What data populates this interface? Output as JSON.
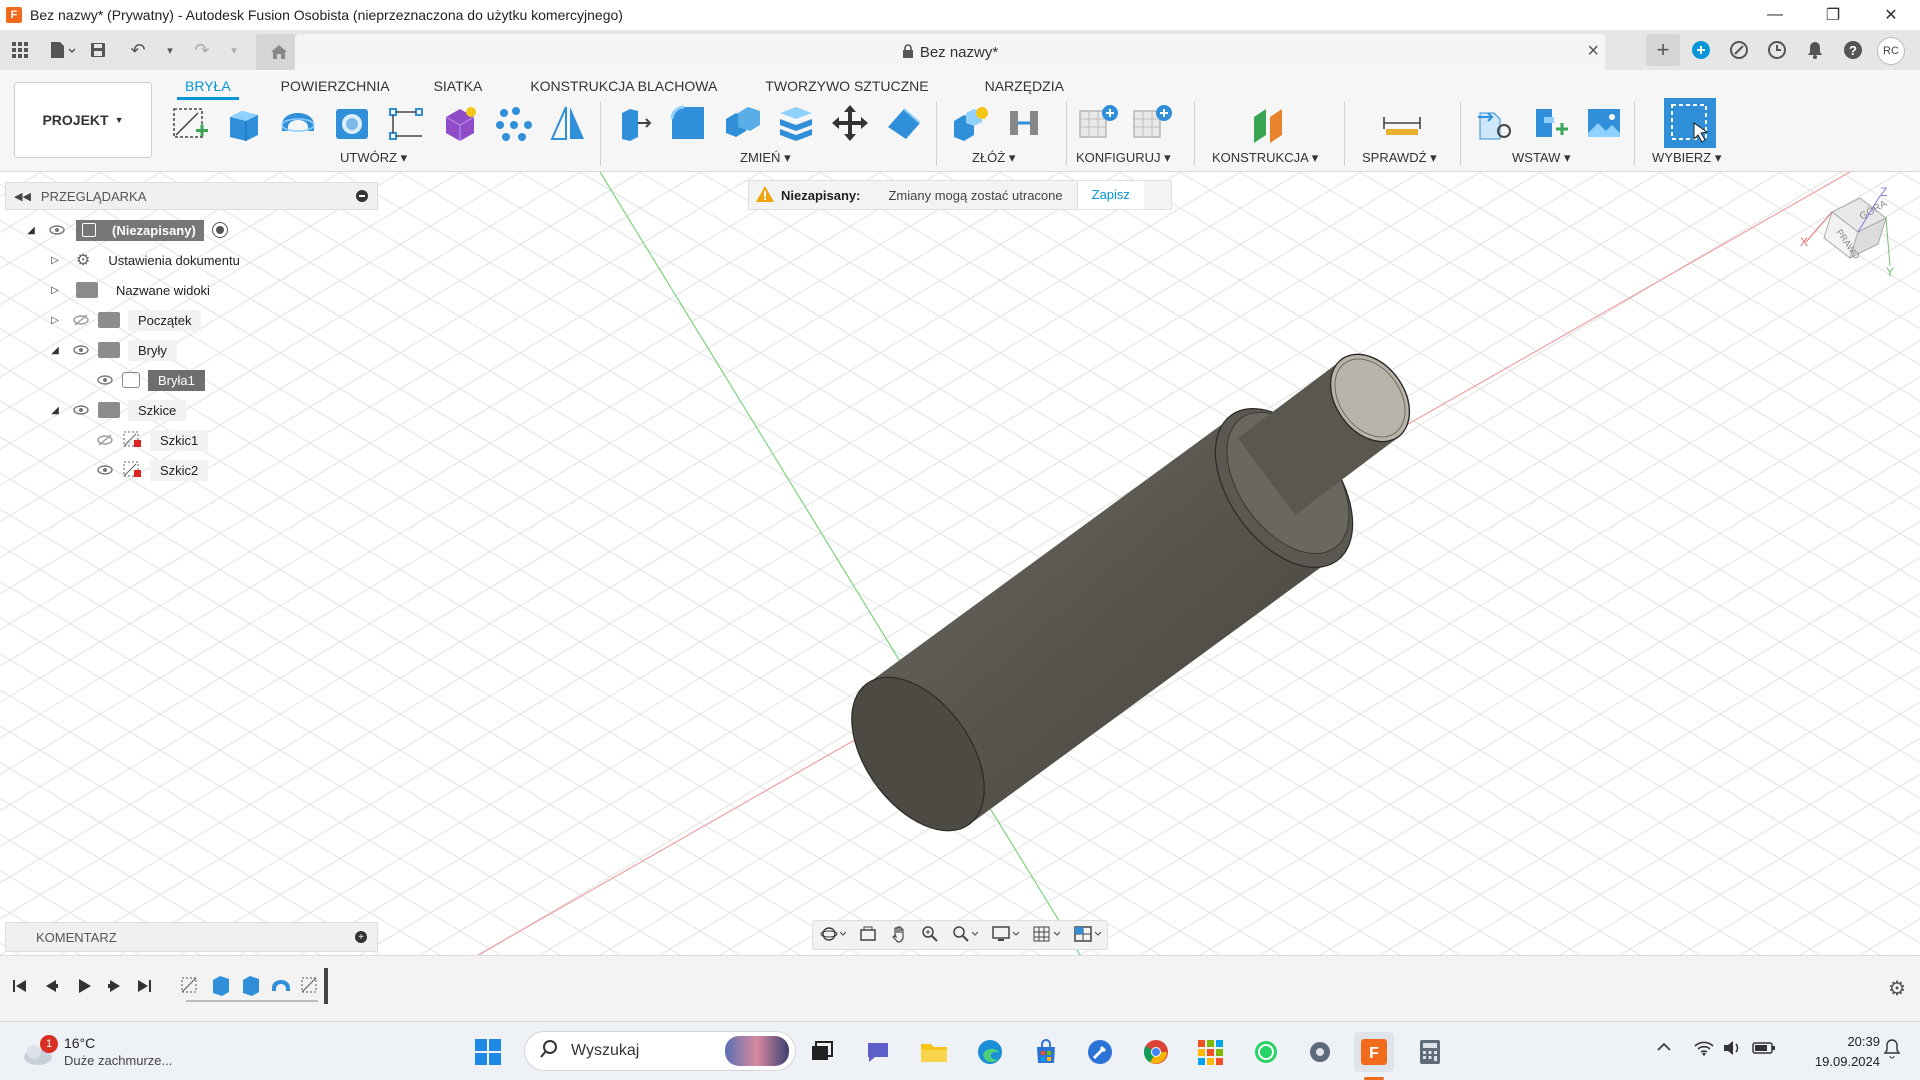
{
  "window": {
    "title": "Bez nazwy* (Prywatny) - Autodesk Fusion Osobista (nieprzeznaczona do użytku komercyjnego)"
  },
  "tabbar": {
    "doc_title": "Bez nazwy*",
    "avatar": "RC"
  },
  "ribbon": {
    "project_label": "PROJEKT",
    "tabs": [
      "BRYŁA",
      "POWIERZCHNIA",
      "SIATKA",
      "KONSTRUKCJA BLACHOWA",
      "TWORZYWO SZTUCZNE",
      "NARZĘDZIA"
    ],
    "active_tab": "BRYŁA",
    "groups": {
      "create": "UTWÓRZ",
      "modify": "ZMIEŃ",
      "assemble": "ZŁÓŻ",
      "configure": "KONFIGURUJ",
      "construct": "KONSTRUKCJA",
      "inspect": "SPRAWDŹ",
      "insert": "WSTAW",
      "select": "WYBIERZ"
    }
  },
  "browser": {
    "header": "PRZEGLĄDARKA",
    "root": "(Niezapisany)",
    "items": {
      "doc_settings": "Ustawienia dokumentu",
      "named_views": "Nazwane widoki",
      "origin": "Początek",
      "bodies": "Bryły",
      "body1": "Bryła1",
      "sketches": "Szkice",
      "sketch1": "Szkic1",
      "sketch2": "Szkic2"
    }
  },
  "warning": {
    "label": "Niezapisany:",
    "message": "Zmiany mogą zostać utracone",
    "action": "Zapisz"
  },
  "comments": {
    "header": "KOMENTARZ"
  },
  "viewcube": {
    "top_face": "GÓRA",
    "right_face": "PRAWO",
    "axis_z": "Z",
    "axis_x": "X",
    "axis_y": "Y"
  },
  "taskbar": {
    "weather_temp": "16°C",
    "weather_desc": "Duże zachmurze...",
    "weather_badge": "1",
    "search_placeholder": "Wyszukaj",
    "time": "20:39",
    "date": "19.09.2024"
  },
  "colors": {
    "accent": "#0696d7",
    "part": "#5f5c55",
    "warning": "#f0a30a"
  }
}
